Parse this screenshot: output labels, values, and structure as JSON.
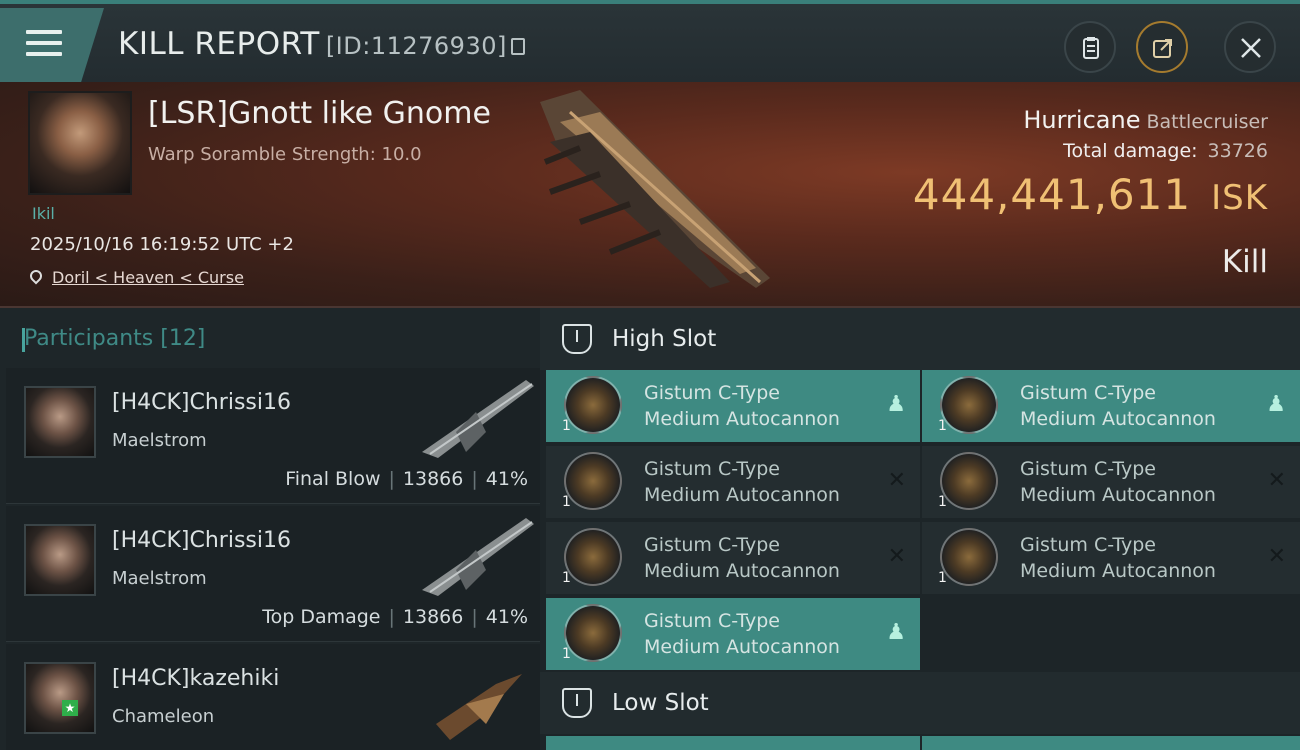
{
  "header": {
    "title": "KILL REPORT",
    "report_id": "[ID:11276930]",
    "icons": [
      "menu-icon",
      "clipboard-icon",
      "share-icon",
      "close-icon"
    ]
  },
  "victim": {
    "pilot": "[LSR]Gnott like Gnome",
    "warp_scramble": "Warp Soramble Strength: 10.0",
    "tag": "Ikil",
    "timestamp": "2025/10/16 16:19:52 UTC +2",
    "location": "Doril < Heaven < Curse",
    "ship": "Hurricane",
    "ship_class": "Battlecruiser",
    "total_damage_label": "Total damage:",
    "total_damage": "33726",
    "isk_value": "444,441,611",
    "isk_unit": "ISK",
    "result": "Kill"
  },
  "participants": {
    "label": "Participants",
    "count": "[12]",
    "rows": [
      {
        "name": "[H4CK]Chrissi16",
        "ship": "Maelstrom",
        "stat_label": "Final Blow",
        "damage": "13866",
        "pct": "41%"
      },
      {
        "name": "[H4CK]Chrissi16",
        "ship": "Maelstrom",
        "stat_label": "Top Damage",
        "damage": "13866",
        "pct": "41%"
      },
      {
        "name": "[H4CK]kazehiki",
        "ship": "Chameleon",
        "stat_label": "",
        "damage": "",
        "pct": ""
      }
    ]
  },
  "fitting": {
    "high_slot_label": "High Slot",
    "low_slot_label": "Low Slot",
    "high_slots": [
      {
        "qty": "1",
        "line1": "Gistum C-Type",
        "line2": "Medium Autocannon",
        "state": "dropped"
      },
      {
        "qty": "1",
        "line1": "Gistum C-Type",
        "line2": "Medium Autocannon",
        "state": "dropped"
      },
      {
        "qty": "1",
        "line1": "Gistum C-Type",
        "line2": "Medium Autocannon",
        "state": "destroyed"
      },
      {
        "qty": "1",
        "line1": "Gistum C-Type",
        "line2": "Medium Autocannon",
        "state": "destroyed"
      },
      {
        "qty": "1",
        "line1": "Gistum C-Type",
        "line2": "Medium Autocannon",
        "state": "destroyed"
      },
      {
        "qty": "1",
        "line1": "Gistum C-Type",
        "line2": "Medium Autocannon",
        "state": "destroyed"
      },
      {
        "qty": "1",
        "line1": "Gistum C-Type",
        "line2": "Medium Autocannon",
        "state": "dropped"
      }
    ]
  },
  "colors": {
    "accent": "#3e8a82",
    "isk": "#f0c074",
    "teal_text": "#3f8a86"
  }
}
